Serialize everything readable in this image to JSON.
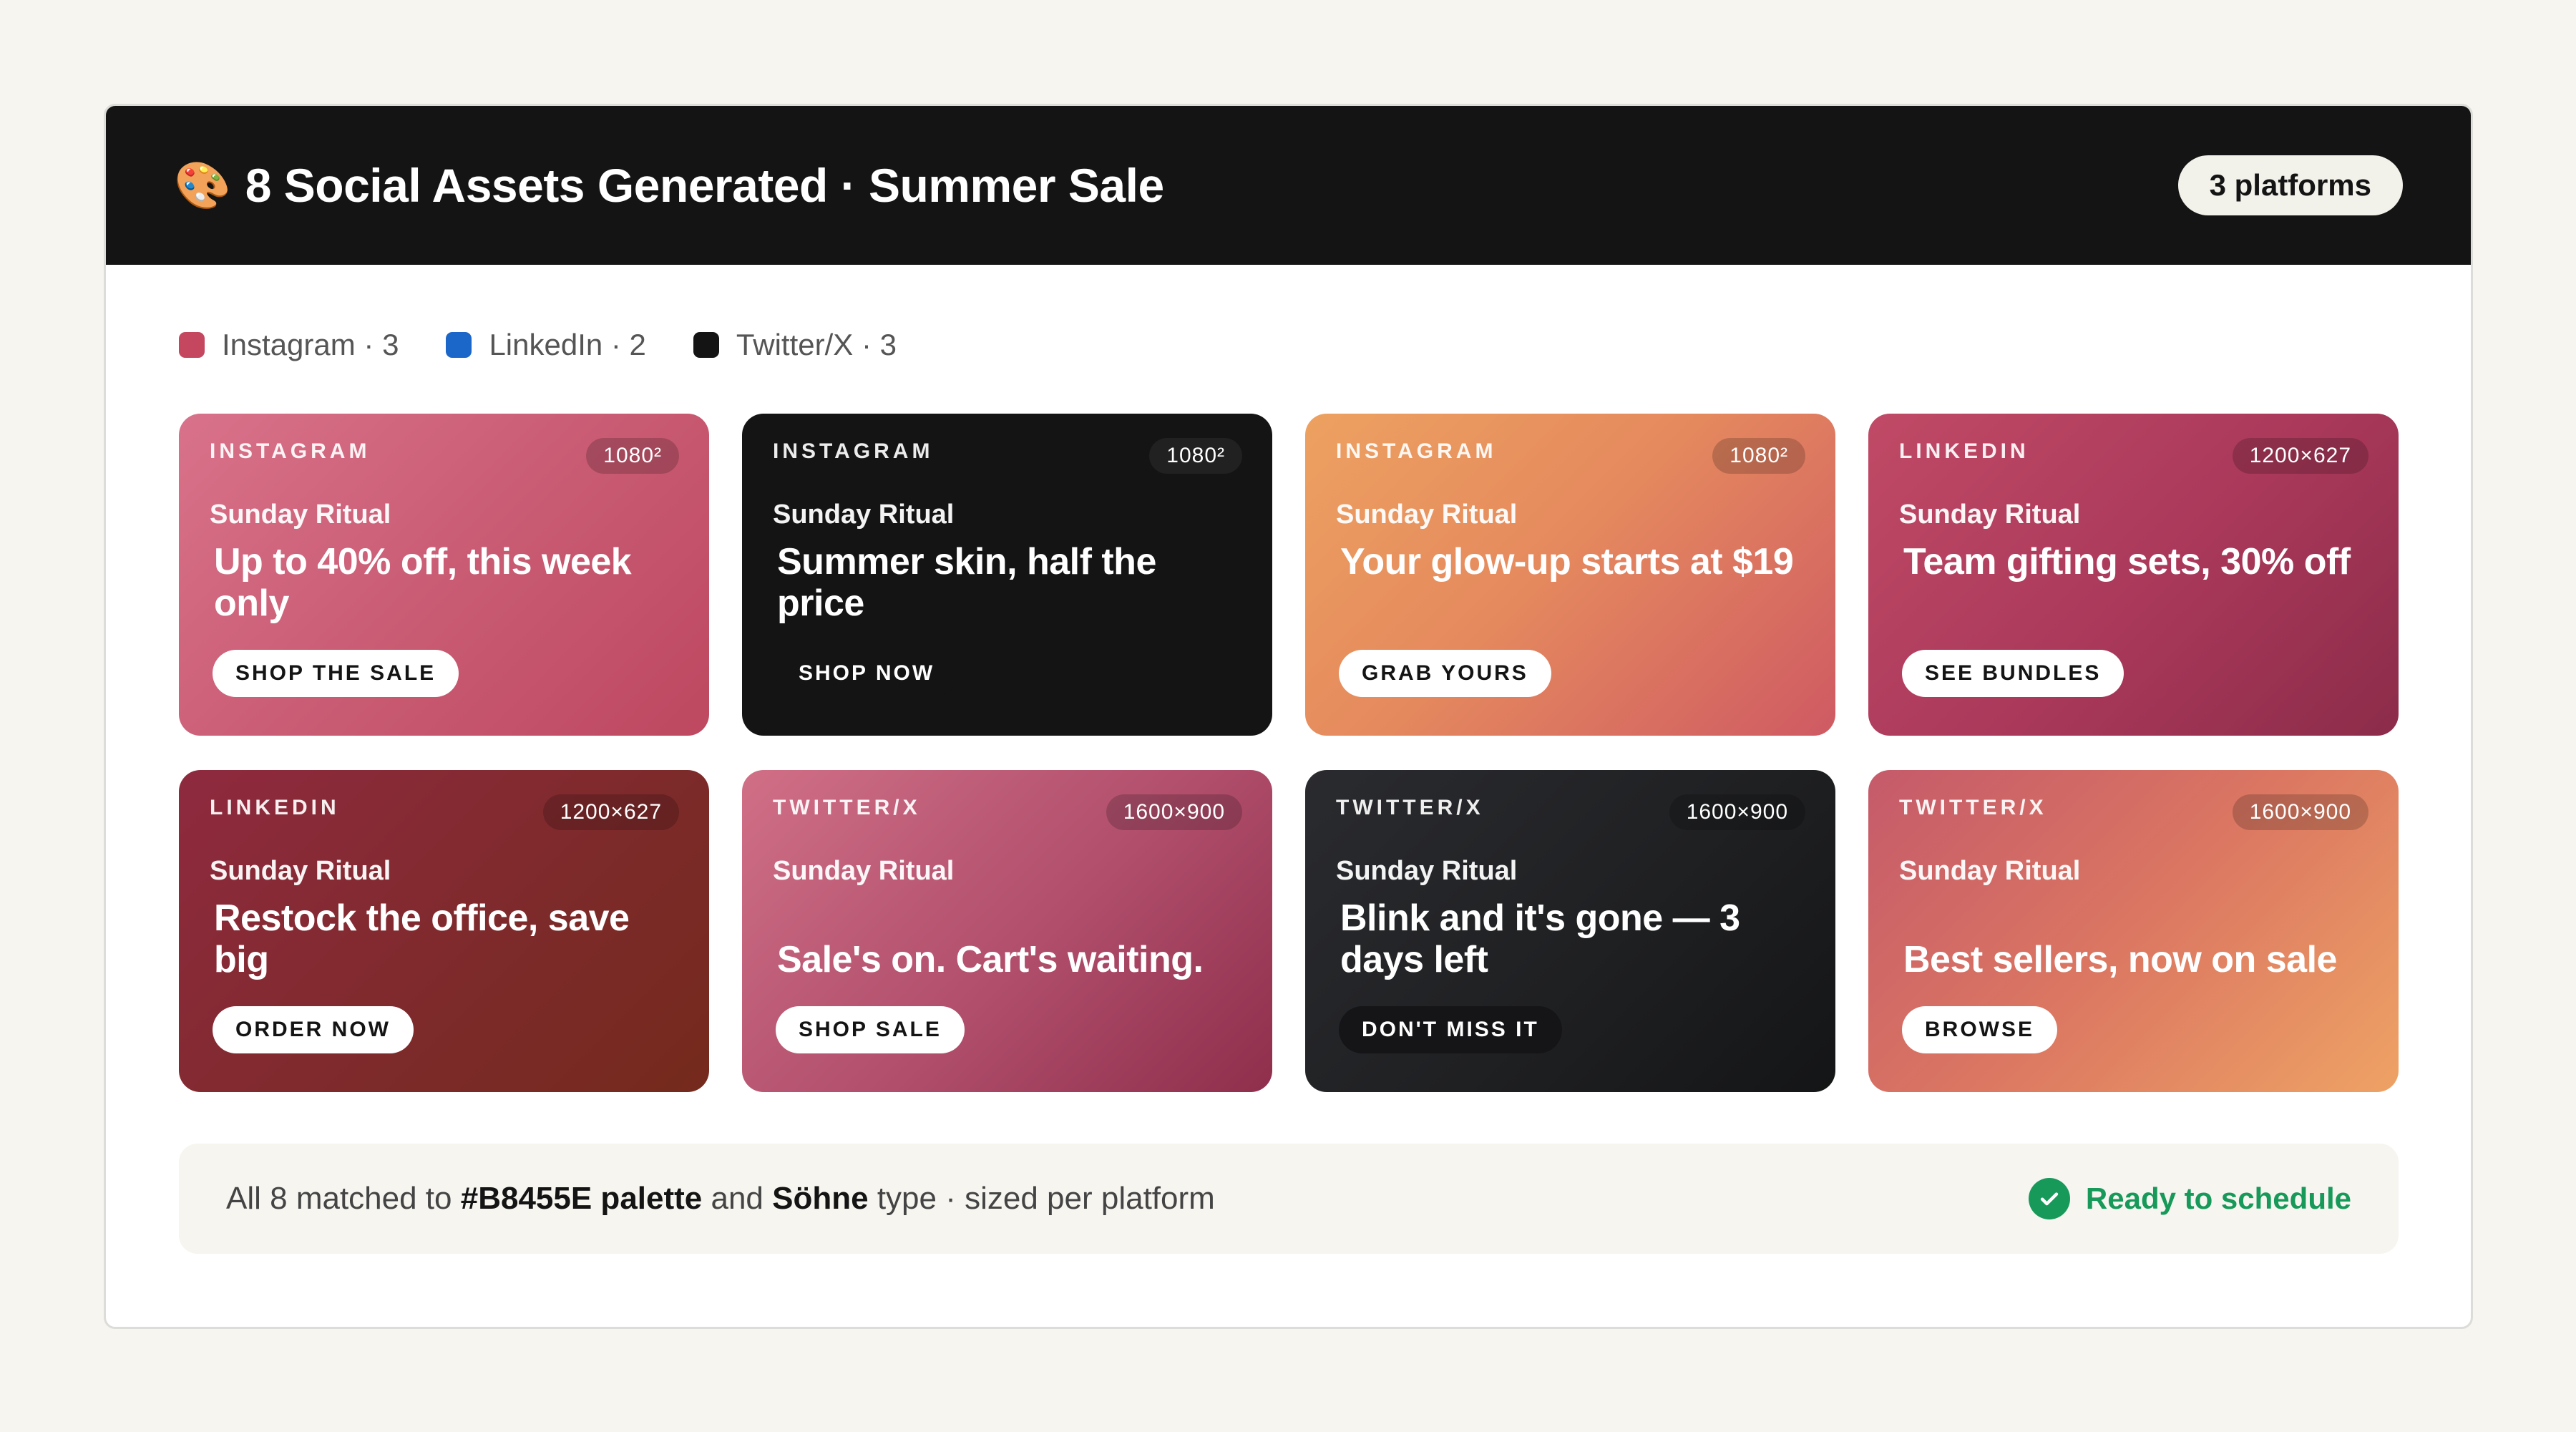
{
  "header": {
    "emoji": "🎨",
    "title": "8 Social Assets Generated · Summer Sale",
    "platform_pill": "3 platforms"
  },
  "legend": [
    {
      "label": "Instagram · 3",
      "color": "#c4475f"
    },
    {
      "label": "LinkedIn · 2",
      "color": "#1a66c9"
    },
    {
      "label": "Twitter/X · 3",
      "color": "#141414"
    }
  ],
  "cards": [
    {
      "platform": "INSTAGRAM",
      "size": "1080²",
      "brand": "Sunday Ritual",
      "headline": "Up to 40% off, this week only",
      "cta": "SHOP THE SALE"
    },
    {
      "platform": "INSTAGRAM",
      "size": "1080²",
      "brand": "Sunday Ritual",
      "headline": "Summer skin, half the price",
      "cta": "SHOP NOW"
    },
    {
      "platform": "INSTAGRAM",
      "size": "1080²",
      "brand": "Sunday Ritual",
      "headline": "Your glow-up starts at $19",
      "cta": "GRAB YOURS"
    },
    {
      "platform": "LINKEDIN",
      "size": "1200×627",
      "brand": "Sunday Ritual",
      "headline": "Team gifting sets, 30% off",
      "cta": "SEE BUNDLES"
    },
    {
      "platform": "LINKEDIN",
      "size": "1200×627",
      "brand": "Sunday Ritual",
      "headline": "Restock the office, save big",
      "cta": "ORDER NOW"
    },
    {
      "platform": "TWITTER/X",
      "size": "1600×900",
      "brand": "Sunday Ritual",
      "headline": "Sale's on. Cart's waiting.",
      "cta": "SHOP SALE"
    },
    {
      "platform": "TWITTER/X",
      "size": "1600×900",
      "brand": "Sunday Ritual",
      "headline": "Blink and it's gone — 3 days left",
      "cta": "DON'T MISS IT"
    },
    {
      "platform": "TWITTER/X",
      "size": "1600×900",
      "brand": "Sunday Ritual",
      "headline": "Best sellers, now on sale",
      "cta": "BROWSE"
    }
  ],
  "footer": {
    "note_pre": "All 8 matched to ",
    "note_palette": "#B8455E palette",
    "note_mid": " and ",
    "note_type": "Söhne",
    "note_post": " type · sized per platform",
    "status": "Ready to schedule"
  }
}
